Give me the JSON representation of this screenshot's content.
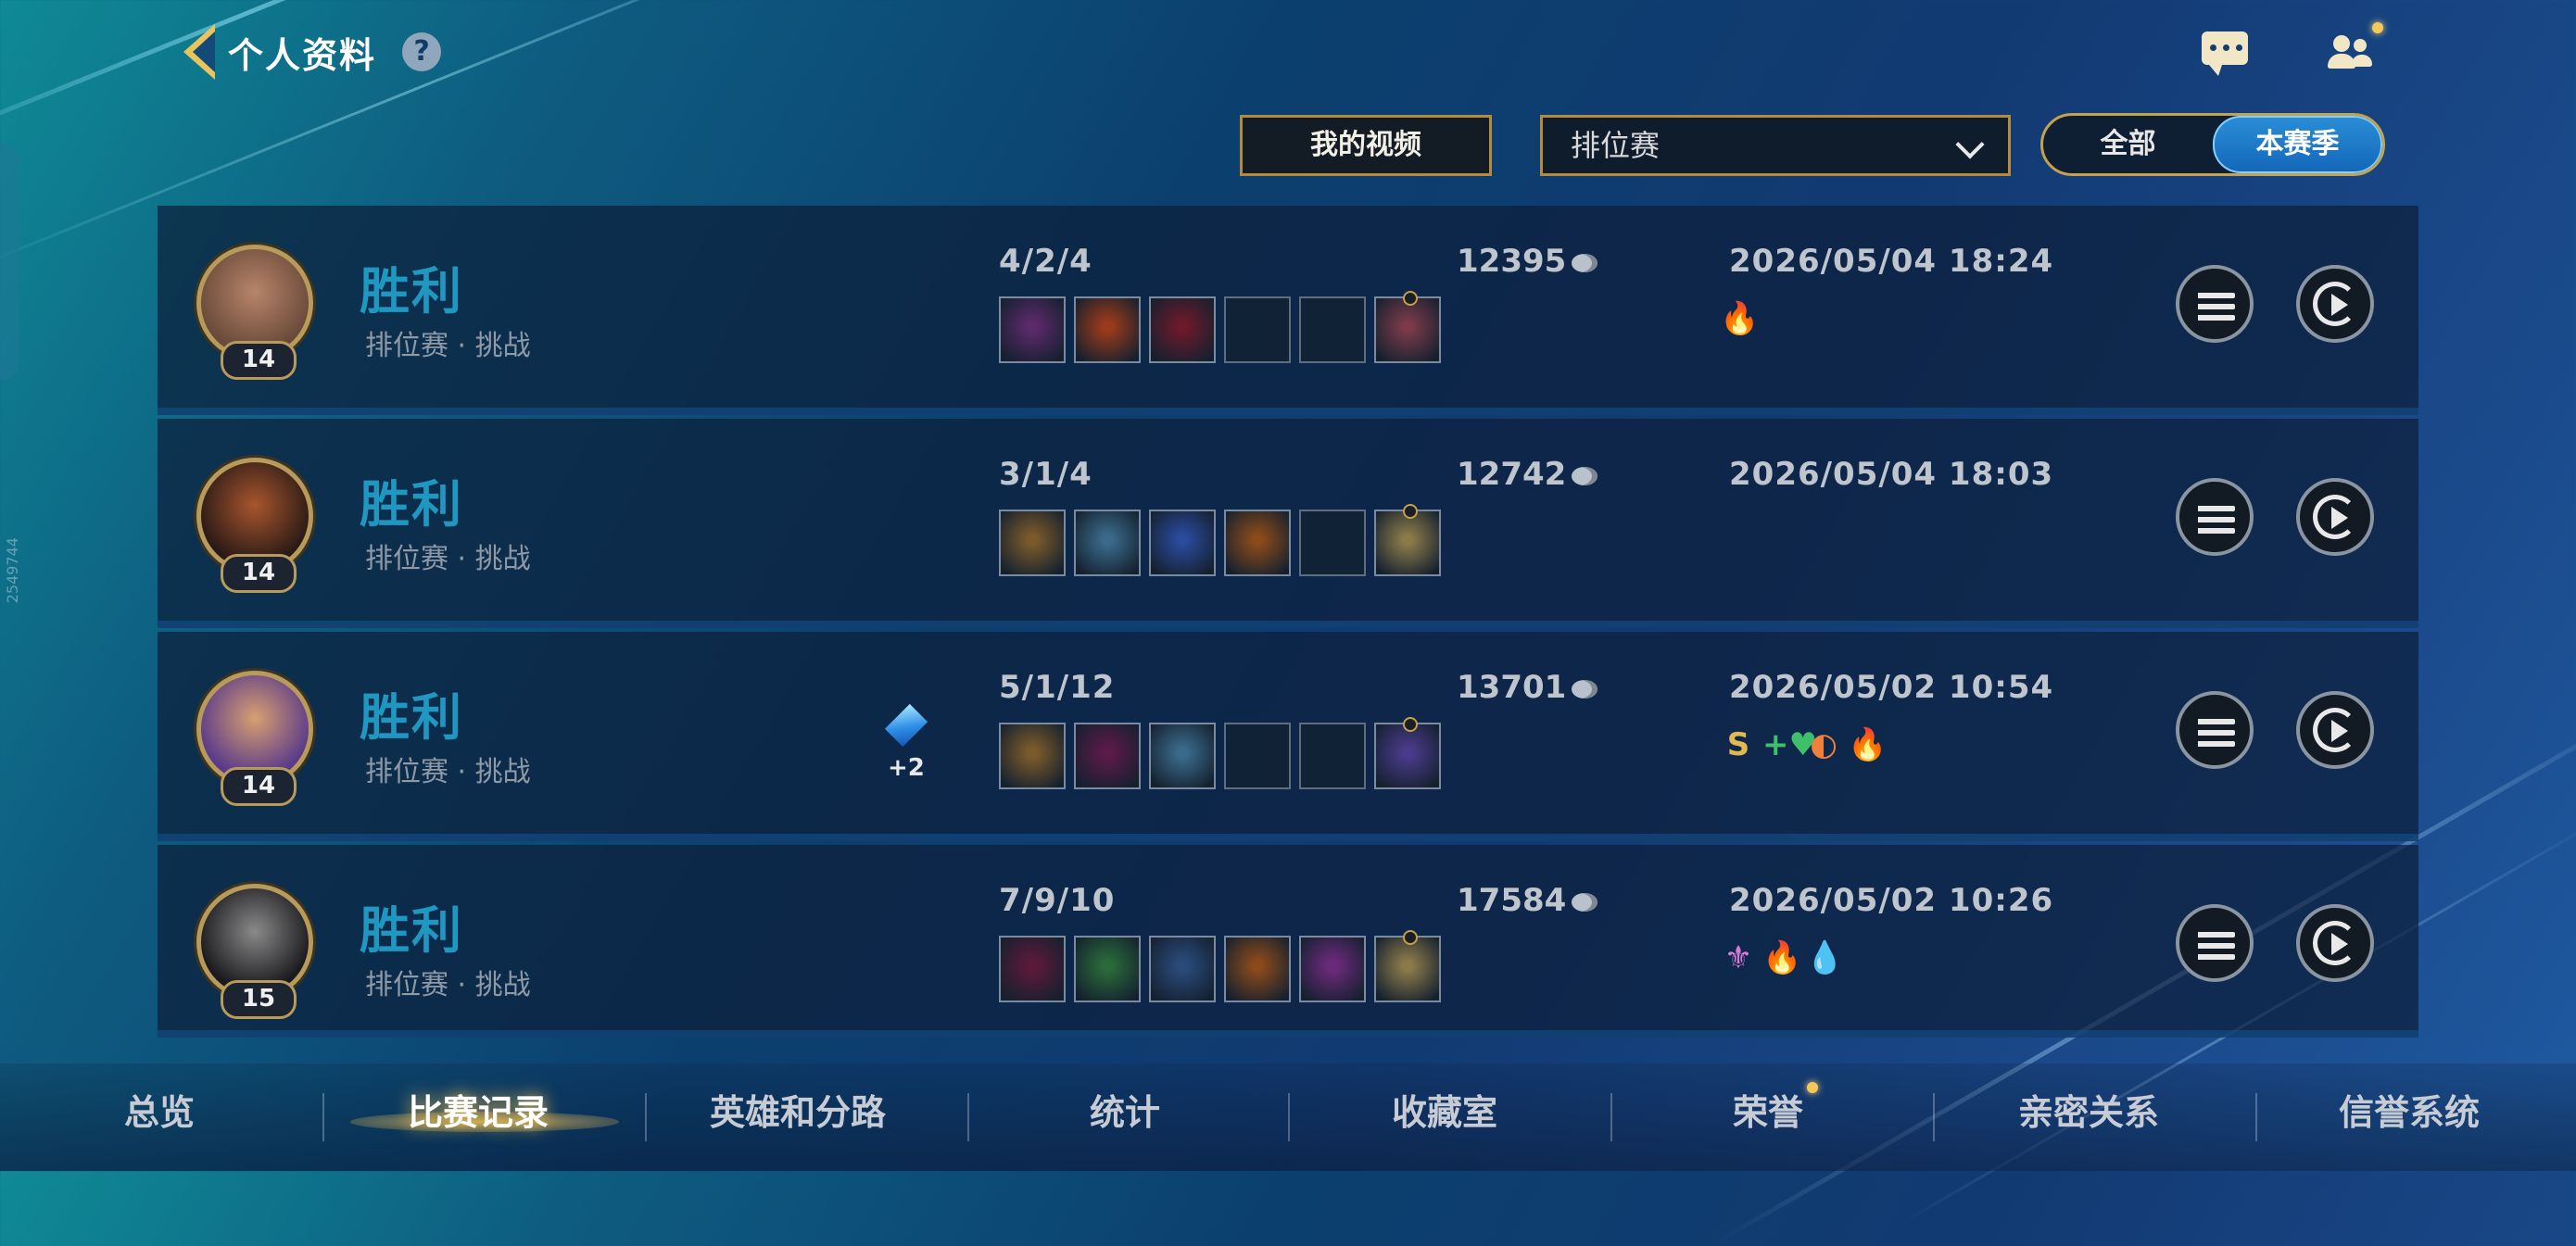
{
  "header": {
    "back_icon": "chevron-left-icon",
    "title": "个人资料",
    "help_label": "?",
    "chat_icon": "chat-icon",
    "friends_icon": "friends-icon"
  },
  "filters": {
    "my_videos": "我的视频",
    "mode_selected": "排位赛",
    "season_all": "全部",
    "season_current": "本赛季",
    "season_selected": "本赛季"
  },
  "side_id": "2549744",
  "matches": [
    {
      "result": "胜利",
      "sub": "排位赛 · 挑战",
      "level": "14",
      "kda": "4/2/4",
      "gold": "12395",
      "datetime": "2026/05/04 18:24",
      "avatar_colors": [
        "#6a4a3a",
        "#b8856a"
      ],
      "item_colors": [
        "#5a2a6a",
        "#9a3a1a",
        "#6a1a2a",
        "",
        "",
        "#7a3a4a"
      ],
      "badges": [
        "🔥"
      ],
      "extra": ""
    },
    {
      "result": "胜利",
      "sub": "排位赛 · 挑战",
      "level": "14",
      "kda": "3/1/4",
      "gold": "12742",
      "datetime": "2026/05/04 18:03",
      "avatar_colors": [
        "#2a1a16",
        "#a8562e"
      ],
      "item_colors": [
        "#7a5a2a",
        "#3a6a8a",
        "#2a4a9a",
        "#8a4a1a",
        "",
        "#8a7a4a"
      ],
      "badges": [],
      "extra": ""
    },
    {
      "result": "胜利",
      "sub": "排位赛 · 挑战",
      "level": "14",
      "kda": "5/1/12",
      "gold": "13701",
      "datetime": "2026/05/02 10:54",
      "avatar_colors": [
        "#5a3a8a",
        "#d8a070"
      ],
      "item_colors": [
        "#7a5a2a",
        "#5a1a4a",
        "#3a6a8a",
        "",
        "",
        "#4a3a8a"
      ],
      "badges": [
        "S",
        "+♥",
        "◐",
        "🔥"
      ],
      "extra": "+2"
    },
    {
      "result": "胜利",
      "sub": "排位赛 · 挑战",
      "level": "15",
      "kda": "7/9/10",
      "gold": "17584",
      "datetime": "2026/05/02 10:26",
      "avatar_colors": [
        "#1a1a1e",
        "#8a8a8a"
      ],
      "item_colors": [
        "#5a1a3a",
        "#2a6a3a",
        "#2a4a7a",
        "#8a4a1a",
        "#6a2a7a",
        "#8a7a4a"
      ],
      "badges": [
        "⚜",
        "🔥",
        "💧"
      ],
      "extra": ""
    }
  ],
  "nav": {
    "overview": "总览",
    "match_history": "比赛记录",
    "champions": "英雄和分路",
    "stats": "统计",
    "collection": "收藏室",
    "honor": "荣誉",
    "relations": "亲密关系",
    "credit": "信誉系统",
    "active": "比赛记录"
  },
  "colors": {
    "accent_gold": "#c5a24d",
    "victory": "#1f97c0",
    "season_active": "#1f7ad0"
  }
}
